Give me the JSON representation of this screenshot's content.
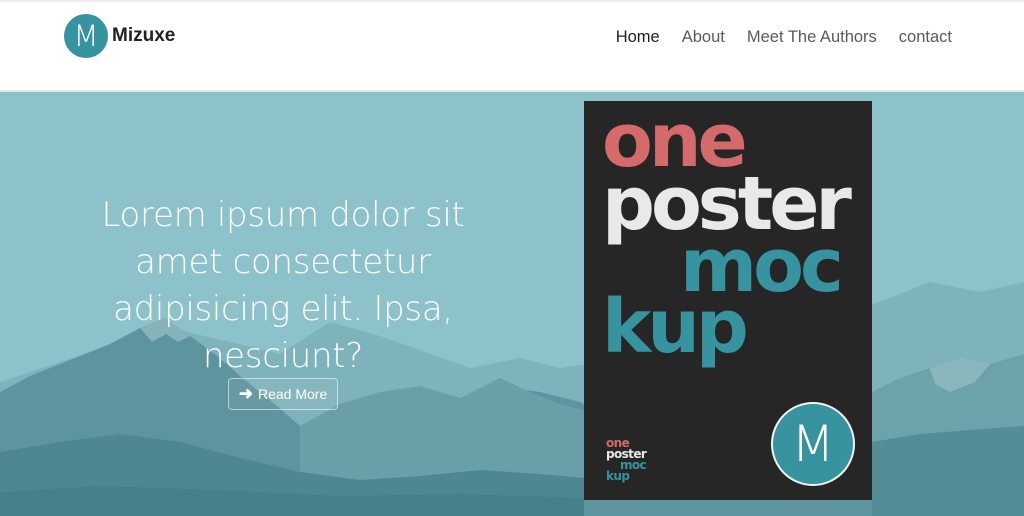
{
  "brand": {
    "logo_letter": "M",
    "name": "Mizuxe"
  },
  "nav": {
    "items": [
      {
        "label": "Home",
        "active": true
      },
      {
        "label": "About"
      },
      {
        "label": "Meet The Authors"
      },
      {
        "label": "contact"
      }
    ]
  },
  "hero": {
    "heading": "Lorem ipsum dolor sit amet consectetur adipisicing elit. Ipsa, nesciunt?",
    "button_label": "Read More",
    "button_icon": "arrow-right-icon"
  },
  "poster": {
    "words": [
      "one",
      "poster",
      "moc",
      "kup"
    ],
    "logo_letter": "M"
  },
  "colors": {
    "accent": "#36939f",
    "poster_red": "#d46a6a",
    "hero_bg": "#8ec2cb",
    "poster_bg": "#262626"
  }
}
